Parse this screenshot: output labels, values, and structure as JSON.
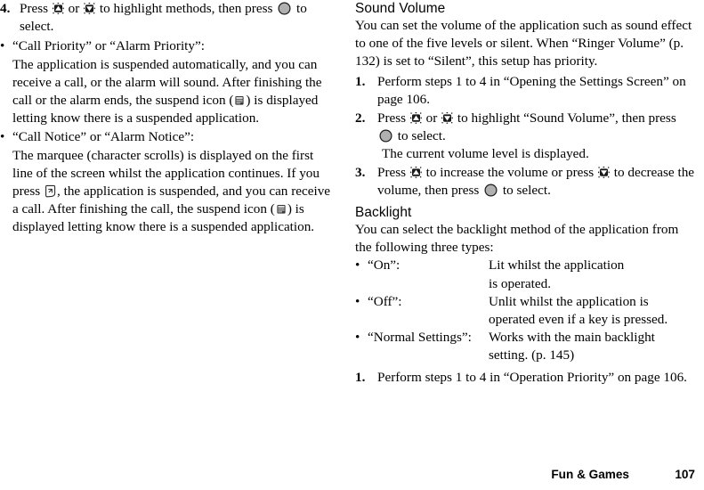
{
  "document": {
    "footer": {
      "section": "Fun & Games",
      "page_number": "107"
    }
  },
  "left_column": {
    "step_4": {
      "number": "4.",
      "text_before_up": "Press",
      "text_between_keys": "or",
      "text_after_keys": "to highlight methods, then press",
      "text_after_select": "to select."
    },
    "bullet_call_priority": {
      "bullet": "•",
      "title": "“Call Priority” or “Alarm Priority”:",
      "body_part_1": "The application is suspended automatically, and you can receive a call, or the alarm will sound. After finishing the call or the alarm ends, the suspend icon (",
      "body_part_2": ") is displayed letting know there is a suspended application."
    },
    "bullet_call_notice": {
      "bullet": "•",
      "title": "“Call Notice” or “Alarm Notice”:",
      "body_part_1": "The marquee (character scrolls) is displayed on the first line of the screen whilst the application continues. If you press",
      "body_part_2": ", the application is suspended, and you can receive a call. After finishing the call, the suspend icon (",
      "body_part_3": ") is displayed letting know there is a suspended application."
    }
  },
  "right_column": {
    "sound_volume": {
      "heading": "Sound Volume",
      "intro": "You can set the volume of the application such as sound effect to one of the five levels or silent. When “Ringer Volume” (p. 132) is set to “Silent”, this setup has priority.",
      "steps": [
        {
          "number": "1.",
          "text": "Perform steps 1 to 4 in “Opening the Settings Screen” on page 106."
        },
        {
          "number": "2.",
          "text_before_up": "Press",
          "text_between_keys": "or",
          "text_after_keys": "to highlight “Sound Volume”, then press",
          "text_after_select": "to select.",
          "note": "The current volume level is displayed."
        },
        {
          "number": "3.",
          "text_before_up": "Press",
          "text_after_up": "to increase the volume or press",
          "text_after_down": "to decrease the volume, then press",
          "text_after_select": "to select."
        }
      ]
    },
    "backlight": {
      "heading": "Backlight",
      "intro": "You can select the backlight method of the application from the following three types:",
      "options": [
        {
          "bullet": "•",
          "term": "“On”:",
          "desc_line_1": "Lit whilst the application",
          "desc_line_2": "is operated."
        },
        {
          "bullet": "•",
          "term": "“Off”:",
          "desc_line_1": "Unlit whilst the application is",
          "desc_line_2": "operated even if a key is pressed."
        },
        {
          "bullet": "•",
          "term": "“Normal Settings”:",
          "desc_line_1": "Works with the main backlight",
          "desc_line_2": "setting. (p. 145)"
        }
      ],
      "steps": [
        {
          "number": "1.",
          "text": "Perform steps 1 to 4 in “Operation Priority” on page 106."
        }
      ]
    }
  },
  "icons": {
    "nav_up": "navigation-up-key-icon",
    "nav_down": "navigation-down-key-icon",
    "select": "center-select-key-icon",
    "soft_key_right": "right-soft-key-icon",
    "suspend": "suspend-application-icon"
  },
  "colors": {
    "text": "#000000",
    "background": "#ffffff",
    "select_key_fill": "#b0b0b0",
    "select_key_stroke": "#1a1a1a",
    "nav_key_fill": "#1a1a1a"
  }
}
